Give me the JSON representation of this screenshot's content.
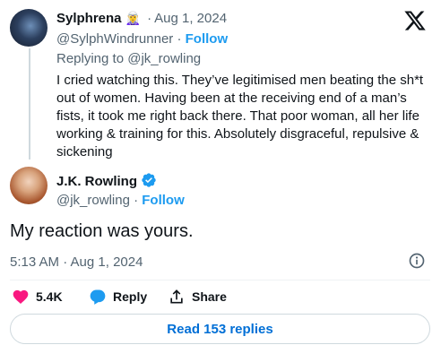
{
  "parent_tweet": {
    "display_name": "Sylphrena",
    "name_emoji": "🧝‍♀️",
    "separator": "·",
    "date": "Aug 1, 2024",
    "handle": "@SylphWindrunner",
    "handle_separator": "·",
    "follow_label": "Follow",
    "replying_to": "Replying to @jk_rowling",
    "text": "I cried watching this. They’ve legitimised men beating the sh*t out of women. Having been at the receiving end of a man’s fists, it took me right back there. That poor woman, all her life working & training for this. Absolutely disgraceful, repulsive & sickening"
  },
  "main_tweet": {
    "display_name": "J.K. Rowling",
    "handle": "@jk_rowling",
    "handle_separator": "·",
    "follow_label": "Follow",
    "text": "My reaction was yours.",
    "timestamp": "5:13 AM · Aug 1, 2024"
  },
  "actions": {
    "likes": "5.4K",
    "reply_label": "Reply",
    "share_label": "Share"
  },
  "read_replies_label": "Read 153 replies",
  "colors": {
    "accent": "#1d9bf0",
    "like_pink": "#f91880",
    "secondary_text": "#536471",
    "link_blue": "#006fd6"
  },
  "icons": [
    "x-logo-icon",
    "verified-badge-icon",
    "info-icon",
    "heart-icon",
    "reply-bubble-icon",
    "share-icon"
  ]
}
